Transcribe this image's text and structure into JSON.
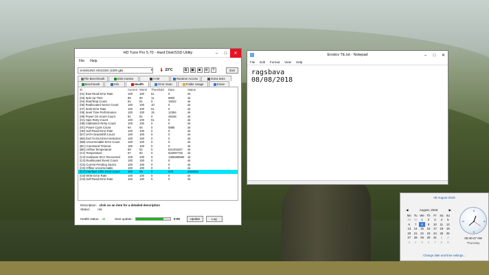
{
  "hdtune": {
    "title": "HD Tune Pro 5.70 - Hard Disk/SSD Utility",
    "menu": [
      "File",
      "Help"
    ],
    "drive": "SAMSUNG HD103SI (1000 gB)",
    "temperature": "23°C",
    "exit_label": "Exit",
    "tabs_row1": [
      "File Benchmark",
      "Disk monitor",
      "AAM",
      "Random Access",
      "Extra tests"
    ],
    "tabs_row2": [
      "Benchmark",
      "Info",
      "Health",
      "Error Scan",
      "Folder Usage",
      "Erase"
    ],
    "active_tab": "Health",
    "columns": [
      "ID",
      "Current",
      "Worst",
      "Threshold",
      "Data",
      "Status"
    ],
    "rows": [
      [
        "(01) Raw Read Error Rate",
        "100",
        "100",
        "51",
        "0",
        "ok"
      ],
      [
        "(03) Spin Up Time",
        "85",
        "80",
        "11",
        "5800",
        "ok"
      ],
      [
        "(04) Start/Stop Count",
        "81",
        "81",
        "0",
        "19322",
        "ok"
      ],
      [
        "(05) Reallocated Sector Count",
        "100",
        "100",
        "10",
        "0",
        "ok"
      ],
      [
        "(07) Seek Error Rate",
        "100",
        "100",
        "51",
        "0",
        "ok"
      ],
      [
        "(08) Seek Time Performance",
        "100",
        "100",
        "15",
        "12354",
        "ok"
      ],
      [
        "(09) Power On Hours Count",
        "91",
        "91",
        "0",
        "48436",
        "ok"
      ],
      [
        "(0A) Spin Retry Count",
        "100",
        "100",
        "51",
        "0",
        "ok"
      ],
      [
        "(0B) Calibration Retry Count",
        "100",
        "100",
        "0",
        "0",
        "ok"
      ],
      [
        "(0C) Power Cycle Count",
        "94",
        "94",
        "0",
        "5885",
        "ok"
      ],
      [
        "(0D) Soft Read Error Rate",
        "100",
        "100",
        "0",
        "0",
        "ok"
      ],
      [
        "(B7) SATA Downshift Count",
        "100",
        "100",
        "0",
        "0",
        "ok"
      ],
      [
        "(B8) End To End Error Detection",
        "100",
        "100",
        "0",
        "0",
        "ok"
      ],
      [
        "(BB) Uncorrectable Error Count",
        "100",
        "100",
        "0",
        "0",
        "ok"
      ],
      [
        "(BC) Command Timeout",
        "100",
        "100",
        "0",
        "0",
        "ok"
      ],
      [
        "(BE) Airflow Temperature",
        "69",
        "52",
        "0",
        "521404447",
        "ok"
      ],
      [
        "(C2) Temperature",
        "67",
        "50",
        "0",
        "622067745",
        "ok"
      ],
      [
        "(C3) Hardware ECC Recovered",
        "100",
        "100",
        "0",
        "1365480960",
        "ok"
      ],
      [
        "(C4) Reallocated Event Count",
        "100",
        "100",
        "0",
        "0",
        "ok"
      ],
      [
        "(C5) Current Pending Sector",
        "100",
        "100",
        "0",
        "0",
        "ok"
      ],
      [
        "(C6) Offline Uncorrectable",
        "100",
        "100",
        "0",
        "0",
        "ok"
      ],
      [
        "(C7) Interface CRC Error Count",
        "100",
        "99",
        "0",
        "678",
        "attention"
      ],
      [
        "(C8) Write Error Rate",
        "100",
        "100",
        "0",
        "0",
        "ok"
      ],
      [
        "(C9) Soft Read Error Rate",
        "100",
        "100",
        "0",
        "0",
        "ok"
      ]
    ],
    "selected_row": 21,
    "description_label": "Description:",
    "description_value": "click on an item for a detailed description",
    "status_label": "Status:",
    "status_value": "n/a",
    "health_status_label": "Health status:",
    "health_status_value": "ok",
    "next_update_label": "Next update:",
    "next_update_value": "0:05",
    "next_update_progress": 0.8,
    "update_label": "Update",
    "log_label": "Log"
  },
  "notepad": {
    "title": "Erodov TE.txt - Notepad",
    "menu": [
      "File",
      "Edit",
      "Format",
      "View",
      "Help"
    ],
    "content": "ragsbava\n08/08/2018"
  },
  "calendar": {
    "long_date": "08 August 2018",
    "month": "August, 2018",
    "weekdays": [
      "Mo",
      "Tu",
      "We",
      "Th",
      "Fr",
      "Sa",
      "Su"
    ],
    "days": [
      "30",
      "31",
      "1",
      "2",
      "3",
      "4",
      "5",
      "6",
      "7",
      "8",
      "9",
      "10",
      "11",
      "12",
      "13",
      "14",
      "15",
      "16",
      "17",
      "18",
      "19",
      "20",
      "21",
      "22",
      "23",
      "24",
      "25",
      "26",
      "27",
      "28",
      "29",
      "30",
      "31",
      "1",
      "2",
      "3",
      "4",
      "5",
      "6",
      "7",
      "8",
      "9"
    ],
    "today_index": 9,
    "time": "05:40:47 AM",
    "weekday": "Thursday",
    "change_link": "Change date and time settings..."
  }
}
